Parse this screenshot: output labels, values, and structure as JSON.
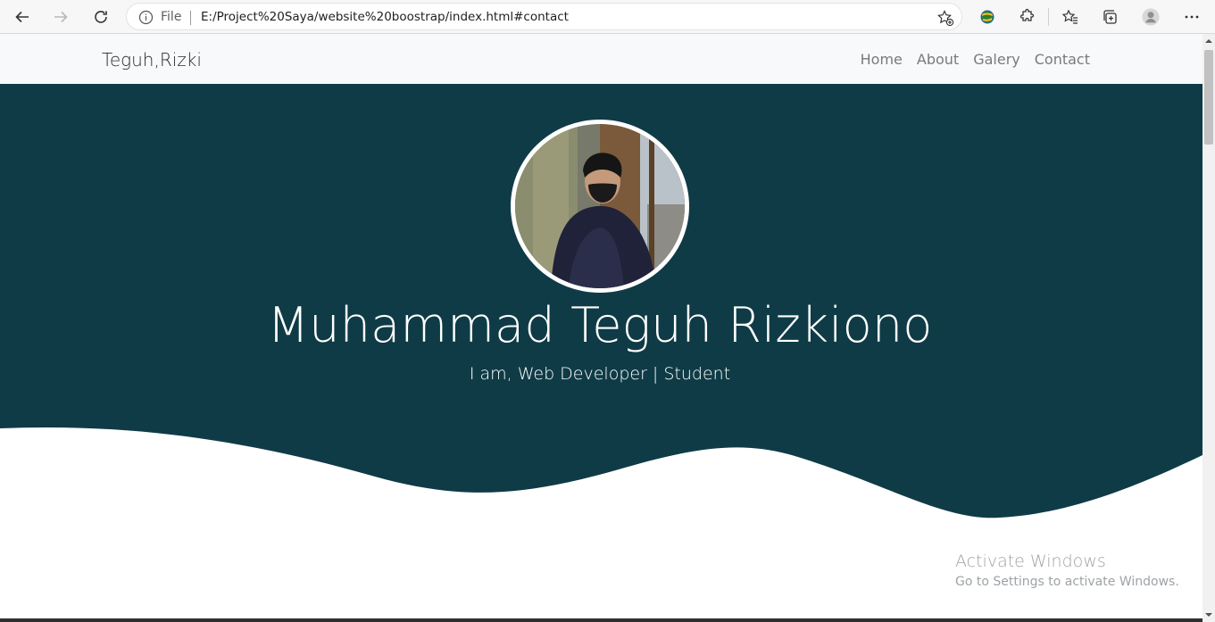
{
  "browser": {
    "file_label": "File",
    "url": "E:/Project%20Saya/website%20boostrap/index.html#contact"
  },
  "navbar": {
    "brand": "Teguh,Rizki",
    "links": [
      "Home",
      "About",
      "Galery",
      "Contact"
    ]
  },
  "hero": {
    "title": "Muhammad Teguh Rizkiono",
    "subtitle": "I am, Web Developer | Student"
  },
  "watermark": {
    "title": "Activate Windows",
    "subtitle": "Go to Settings to activate Windows."
  },
  "colors": {
    "hero_bg": "#0f3b46",
    "navbar_bg": "#f8f9fa"
  },
  "icons": [
    "back-icon",
    "forward-icon",
    "refresh-icon",
    "info-icon",
    "add-favorite-icon",
    "extension-globe-icon",
    "extensions-icon",
    "favorites-icon",
    "collections-icon",
    "profile-icon",
    "more-icon"
  ]
}
